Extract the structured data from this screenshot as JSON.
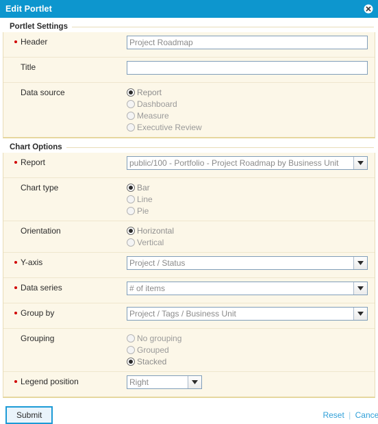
{
  "window": {
    "title": "Edit Portlet",
    "close_icon": "close-circle-icon",
    "accent_color": "#0d96ce"
  },
  "sections": [
    {
      "id": "portlet-settings",
      "title": "Portlet Settings"
    },
    {
      "id": "chart-options",
      "title": "Chart Options"
    }
  ],
  "fields": {
    "header": {
      "label": "Header",
      "required": true,
      "value": "Project Roadmap",
      "placeholder": "Project Roadmap"
    },
    "title": {
      "label": "Title",
      "required": false,
      "value": "",
      "placeholder": ""
    },
    "data_source": {
      "label": "Data source",
      "required": false,
      "selected": "Report",
      "options": [
        "Report",
        "Dashboard",
        "Measure",
        "Executive Review"
      ]
    },
    "report": {
      "label": "Report",
      "required": true,
      "value": "public/100 - Portfolio - Project Roadmap by Business Unit",
      "arrow_icon": "chevron-down-icon"
    },
    "chart_type": {
      "label": "Chart type",
      "required": false,
      "selected": "Bar",
      "options": [
        "Bar",
        "Line",
        "Pie"
      ]
    },
    "orientation": {
      "label": "Orientation",
      "required": false,
      "selected": "Horizontal",
      "options": [
        "Horizontal",
        "Vertical"
      ]
    },
    "y_axis": {
      "label": "Y-axis",
      "required": true,
      "value": "Project / Status",
      "arrow_icon": "chevron-down-icon"
    },
    "data_series": {
      "label": "Data series",
      "required": true,
      "value": "# of items",
      "arrow_icon": "chevron-down-icon"
    },
    "group_by": {
      "label": "Group by",
      "required": true,
      "value": "Project / Tags / Business Unit",
      "arrow_icon": "chevron-down-icon"
    },
    "grouping": {
      "label": "Grouping",
      "required": false,
      "selected": "Stacked",
      "options": [
        "No grouping",
        "Grouped",
        "Stacked"
      ]
    },
    "legend_position": {
      "label": "Legend position",
      "required": true,
      "value": "Right",
      "arrow_icon": "chevron-down-icon"
    }
  },
  "footer": {
    "submit_label": "Submit",
    "reset_label": "Reset",
    "separator": "|",
    "cancel_label": "Cancel"
  }
}
